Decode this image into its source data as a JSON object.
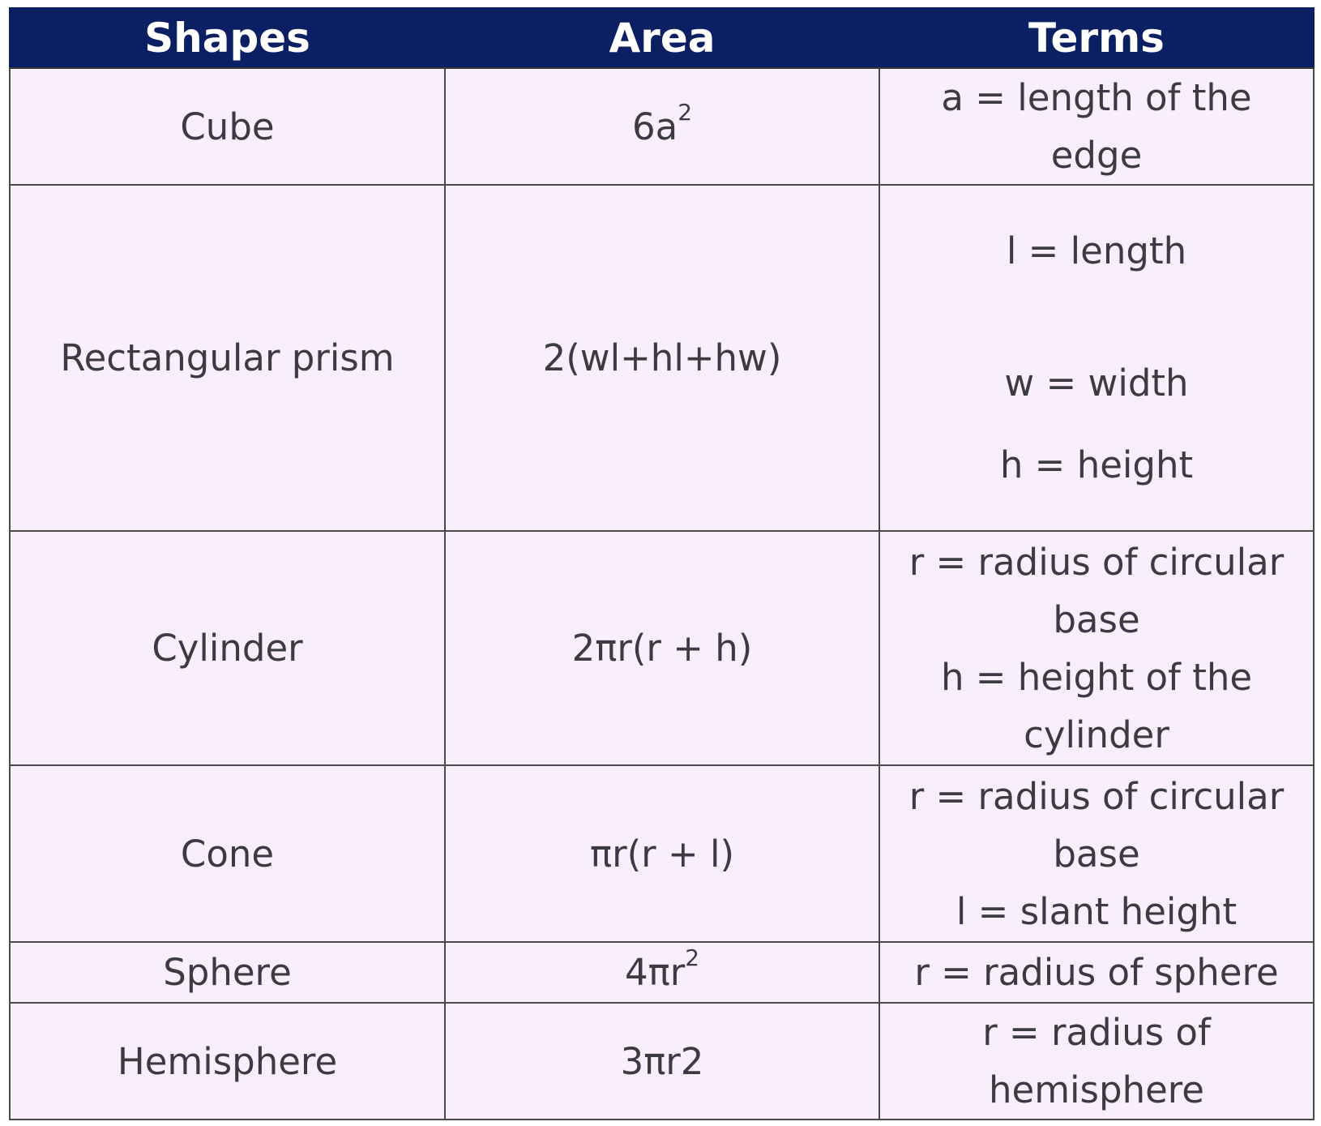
{
  "table": {
    "headers": [
      "Shapes",
      "Area",
      "Terms"
    ],
    "rows": [
      {
        "shape": "Cube",
        "area_base": "6a",
        "area_sup": "2",
        "terms": [
          "a = length of the",
          "edge"
        ]
      },
      {
        "shape": "Rectangular prism",
        "area_base": "2(wl+hl+hw)",
        "area_sup": "",
        "terms": [
          "l = length",
          "w = width",
          "h = height"
        ]
      },
      {
        "shape": "Cylinder",
        "area_base": "2πr(r + h)",
        "area_sup": "",
        "terms": [
          "r = radius of circular",
          "base",
          "h = height of the",
          "cylinder"
        ]
      },
      {
        "shape": "Cone",
        "area_base": "πr(r + l)",
        "area_sup": "",
        "terms": [
          "r = radius of circular",
          "base",
          "l = slant height"
        ]
      },
      {
        "shape": "Sphere",
        "area_base": "4πr",
        "area_sup": "2",
        "terms": [
          "r = radius of sphere"
        ]
      },
      {
        "shape": "Hemisphere",
        "area_base": "3πr2",
        "area_sup": "",
        "terms": [
          "r = radius of",
          "hemisphere"
        ]
      }
    ]
  }
}
